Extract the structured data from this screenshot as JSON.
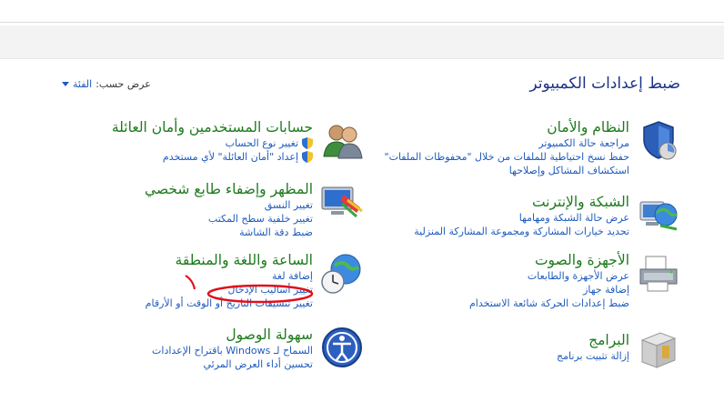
{
  "header": {
    "title": "ضبط إعدادات الكمبيوتر",
    "view_by_label": "عرض حسب:",
    "view_by_value": "الفئة"
  },
  "categories": {
    "system": {
      "title": "النظام والأمان",
      "links": [
        "مراجعة حالة الكمبيوتر",
        "حفظ نسخ احتياطية للملفات من خلال \"محفوظات الملفات\"",
        "استكشاف المشاكل وإصلاحها"
      ]
    },
    "network": {
      "title": "الشبكة والإنترنت",
      "links": [
        "عرض حالة الشبكة ومهامها",
        "تحديد خيارات المشاركة ومجموعة المشاركة المنزلية"
      ]
    },
    "hardware": {
      "title": "الأجهزة والصوت",
      "links": [
        "عرض الأجهزة والطابعات",
        "إضافة جهاز",
        "ضبط إعدادات الحركة شائعة الاستخدام"
      ]
    },
    "programs": {
      "title": "البرامج",
      "links": [
        "إزالة تثبيت برنامج"
      ]
    },
    "users": {
      "title": "حسابات المستخدمين وأمان العائلة",
      "links": [
        "تغيير نوع الحساب",
        "إعداد \"أمان العائلة\" لأي مستخدم"
      ]
    },
    "appearance": {
      "title": "المظهر وإضفاء طابع شخصي",
      "links": [
        "تغيير النسق",
        "تغيير خلفية سطح المكتب",
        "ضبط دقة الشاشة"
      ]
    },
    "clock": {
      "title": "الساعة واللغة والمنطقة",
      "links": [
        "إضافة لغة",
        "تغيير أساليب الإدخال",
        "تغيير تنسيقات التاريخ أو الوقت أو الأرقام"
      ]
    },
    "ease": {
      "title": "سهولة الوصول",
      "links": [
        "السماح لـ Windows باقتراح الإعدادات",
        "تحسين أداء العرض المرئي"
      ]
    }
  },
  "colors": {
    "title_blue": "#1e3287",
    "category_green": "#1e7a1e",
    "link_blue": "#1e5bbd",
    "annotation_red": "#e0101a"
  }
}
